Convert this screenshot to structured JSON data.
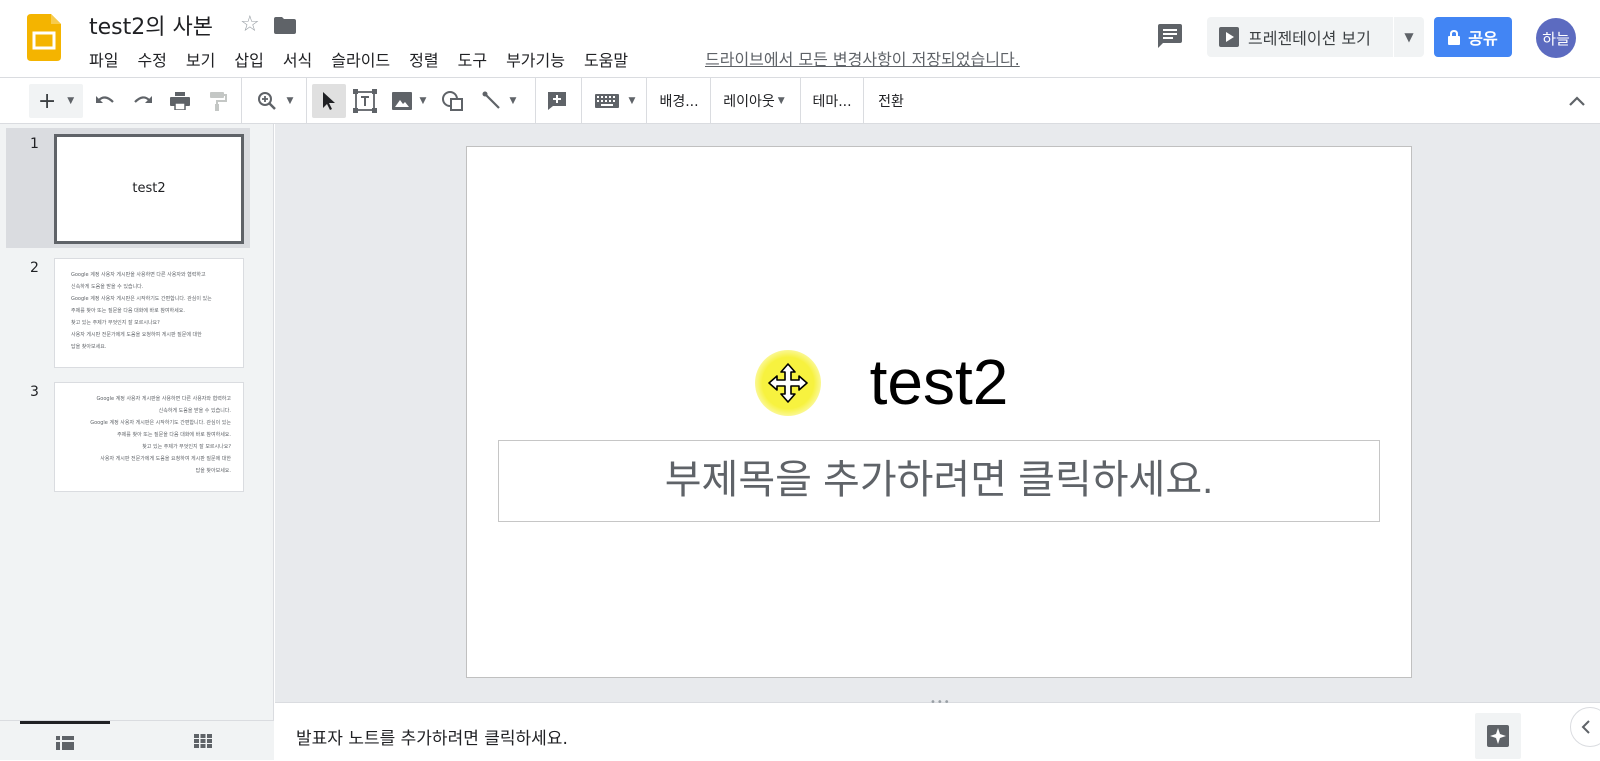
{
  "header": {
    "doc_title": "test2의 사본",
    "menu": [
      "파일",
      "수정",
      "보기",
      "삽입",
      "서식",
      "슬라이드",
      "정렬",
      "도구",
      "부가기능",
      "도움말"
    ],
    "saved_status": "드라이브에서 모든 변경사항이 저장되었습니다.",
    "present_label": "프레젠테이션 보기",
    "share_label": "공유",
    "avatar_label": "하늘"
  },
  "toolbar": {
    "background_label": "배경...",
    "layout_label": "레이아웃",
    "theme_label": "테마...",
    "transition_label": "전환"
  },
  "filmstrip": {
    "slides": [
      {
        "number": "1",
        "title": "test2"
      },
      {
        "number": "2",
        "lines": [
          "Google 계정 사용자 게시판을 사용하면 다른 사용자와 협력하고",
          "신속하게 도움을 받을 수 있습니다.",
          "Google 계정 사용자 게시판은 시작하기도 간편합니다. 관심이 있는",
          "주제를 찾아 또는 질문을 다음 대화에 바로 참여하세요.",
          "찾고 있는 주제가 무엇인지 잘 모르시나요?",
          "사용자 게시판 전문가에게 도움을 요청하여 게시판 질문에 대한",
          "답을 찾아보세요."
        ]
      },
      {
        "number": "3",
        "lines": [
          "Google 계정 사용자 게시판을 사용하면 다른 사용자와 협력하고",
          "신속하게 도움을 받을 수 있습니다.",
          "Google 계정 사용자 게시판은 시작하기도 간편합니다. 관심이 있는",
          "주제를 찾아 또는 질문을 다음 대화에 바로 참여하세요.",
          "찾고 있는 주제가 무엇인지 잘 모르시나요?",
          "사용자 게시판 전문가에게 도움을 요청하여 게시판 질문에 대한",
          "답을 찾아보세요."
        ]
      }
    ]
  },
  "slide": {
    "title": "test2",
    "subtitle_placeholder": "부제목을 추가하려면 클릭하세요."
  },
  "notes": {
    "placeholder": "발표자 노트를 추가하려면 클릭하세요."
  },
  "colors": {
    "accent": "#4285f4",
    "logo": "#f4b400",
    "avatar": "#5c6bc0",
    "cursor_highlight": "#f7f23f"
  },
  "icons": [
    "slides-logo-icon",
    "star-icon",
    "folder-icon",
    "comment-icon",
    "play-icon",
    "lock-icon",
    "new-slide-icon",
    "undo-icon",
    "redo-icon",
    "print-icon",
    "paint-format-icon",
    "zoom-icon",
    "select-icon",
    "textbox-icon",
    "image-icon",
    "shape-icon",
    "line-icon",
    "comment-add-icon",
    "input-tools-icon",
    "collapse-icon",
    "move-icon",
    "explore-icon",
    "list-view-icon",
    "grid-view-icon"
  ]
}
